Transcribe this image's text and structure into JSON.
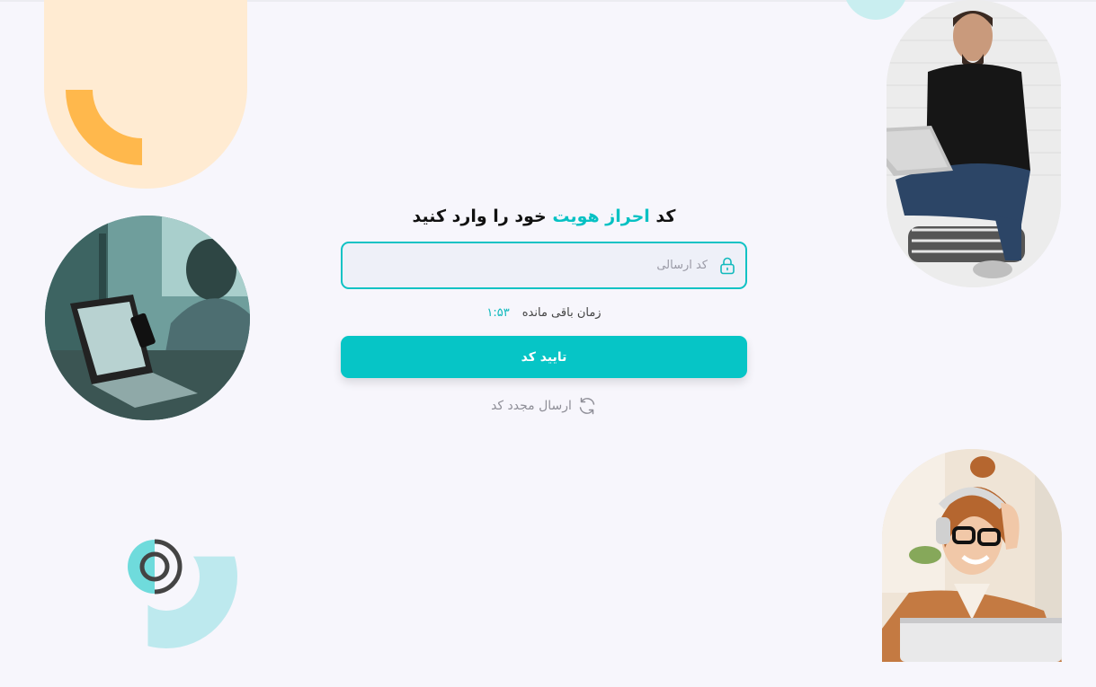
{
  "heading": {
    "part1": "کد",
    "accent": "احراز هویت",
    "part2": "خود را وارد کنید"
  },
  "code_input": {
    "placeholder": "کد ارسالی",
    "value": "",
    "icon": "lock-icon"
  },
  "timer": {
    "label": "زمان باقی مانده",
    "value": "۱:۵۳"
  },
  "confirm_button": {
    "label": "تایید کد"
  },
  "resend": {
    "label": "ارسال مجدد کد",
    "icon": "refresh-icon"
  },
  "colors": {
    "accent": "#06c5c6",
    "background": "#f7f6fc",
    "peach": "#ffebd2",
    "orange": "#ffb84c",
    "light_teal": "#bde9ee"
  }
}
